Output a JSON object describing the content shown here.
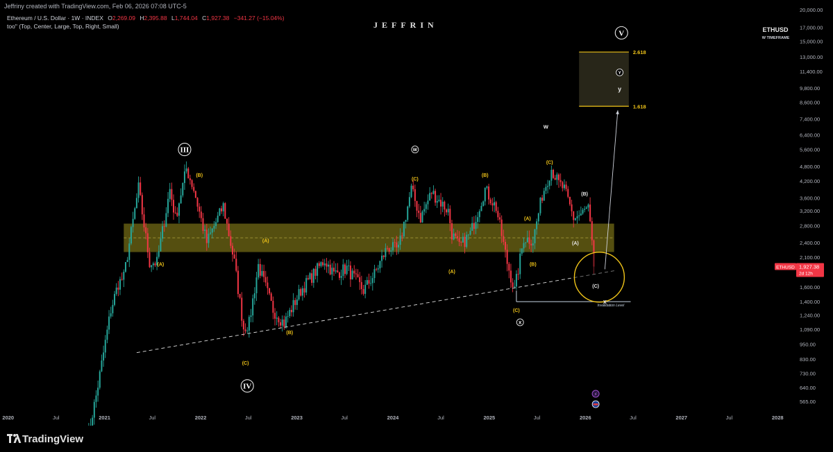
{
  "header": {
    "caption": "Jeffriny created with TradingView.com, Feb 06, 2026 07:08 UTC-5",
    "ohlc_title": "Ethereum / U.S. Dollar · 1W · INDEX",
    "o_label": "O",
    "o_value": "2,269.09",
    "h_label": "H",
    "h_value": "2,395.88",
    "l_label": "L",
    "l_value": "1,744.04",
    "c_label": "C",
    "c_value": "1,927.38",
    "change": "−341.27 (−15.04%)",
    "indicator": "too\" (Top, Center, Large, Top, Right, Small)",
    "brand": "JEFFRIN",
    "symbol": "ETHUSD",
    "timeframe": "W TIMEFRAME"
  },
  "footer": {
    "logo_text": "TradingView"
  },
  "colors": {
    "up": "#26a69a",
    "down": "#f23645",
    "zone": "#9a8f1e",
    "label": "#f0c419",
    "axis_text": "#b2b5be",
    "price_tag": "#f23645"
  },
  "chart_data": {
    "type": "candlestick",
    "y_scale": "log",
    "ylim": [
      520,
      20000
    ],
    "x_range": [
      "2019-12-01",
      "2028-03-01"
    ],
    "y_ticks": [
      565,
      640,
      730,
      830,
      950,
      1090,
      1240,
      1400,
      1600,
      2100,
      2400,
      2800,
      3200,
      3600,
      4200,
      4800,
      5600,
      6400,
      7400,
      8600,
      9800,
      11400,
      13000,
      15000,
      17000,
      20000
    ],
    "y_tick_labels": [
      "565.00",
      "640.00",
      "730.00",
      "830.00",
      "950.00",
      "1,090.00",
      "1,240.00",
      "1,400.00",
      "1,600.00",
      "2,100.00",
      "2,400.00",
      "2,800.00",
      "3,200.00",
      "3,600.00",
      "4,200.00",
      "4,800.00",
      "5,600.00",
      "6,400.00",
      "7,400.00",
      "8,600.00",
      "9,800.00",
      "11,400.00",
      "13,000.00",
      "15,000.00",
      "17,000.00",
      "20,000.00"
    ],
    "x_ticks": [
      {
        "date": "2020-01-01",
        "label": "2020",
        "bold": true
      },
      {
        "date": "2020-07-01",
        "label": "Jul",
        "bold": false
      },
      {
        "date": "2021-01-01",
        "label": "2021",
        "bold": true
      },
      {
        "date": "2021-07-01",
        "label": "Jul",
        "bold": false
      },
      {
        "date": "2022-01-01",
        "label": "2022",
        "bold": true
      },
      {
        "date": "2022-07-01",
        "label": "Jul",
        "bold": false
      },
      {
        "date": "2023-01-01",
        "label": "2023",
        "bold": true
      },
      {
        "date": "2023-07-01",
        "label": "Jul",
        "bold": false
      },
      {
        "date": "2024-01-01",
        "label": "2024",
        "bold": true
      },
      {
        "date": "2024-07-01",
        "label": "Jul",
        "bold": false
      },
      {
        "date": "2025-01-01",
        "label": "2025",
        "bold": true
      },
      {
        "date": "2025-07-01",
        "label": "Jul",
        "bold": false
      },
      {
        "date": "2026-01-01",
        "label": "2026",
        "bold": true
      },
      {
        "date": "2026-07-01",
        "label": "Jul",
        "bold": false
      },
      {
        "date": "2027-01-01",
        "label": "2027",
        "bold": true
      },
      {
        "date": "2027-07-01",
        "label": "Jul",
        "bold": false
      },
      {
        "date": "2028-01-01",
        "label": "2028",
        "bold": true
      }
    ],
    "price_anchors": [
      [
        "2020-10-26",
        395
      ],
      [
        "2020-12-01",
        600
      ],
      [
        "2021-01-25",
        1300
      ],
      [
        "2021-02-22",
        1650
      ],
      [
        "2021-03-15",
        1750
      ],
      [
        "2021-05-10",
        3950
      ],
      [
        "2021-06-21",
        2000
      ],
      [
        "2021-07-19",
        2000
      ],
      [
        "2021-09-06",
        3900
      ],
      [
        "2021-09-27",
        3000
      ],
      [
        "2021-11-08",
        4700
      ],
      [
        "2021-12-06",
        3900
      ],
      [
        "2022-01-24",
        2400
      ],
      [
        "2022-03-28",
        3350
      ],
      [
        "2022-05-09",
        2000
      ],
      [
        "2022-06-13",
        1100
      ],
      [
        "2022-07-04",
        1150
      ],
      [
        "2022-08-08",
        1950
      ],
      [
        "2022-10-03",
        1300
      ],
      [
        "2022-11-14",
        1150
      ],
      [
        "2023-01-16",
        1550
      ],
      [
        "2023-04-17",
        2050
      ],
      [
        "2023-05-22",
        1800
      ],
      [
        "2023-07-10",
        1900
      ],
      [
        "2023-09-11",
        1550
      ],
      [
        "2023-10-23",
        1800
      ],
      [
        "2023-12-11",
        2300
      ],
      [
        "2024-01-22",
        2250
      ],
      [
        "2024-03-11",
        3900
      ],
      [
        "2024-04-15",
        3000
      ],
      [
        "2024-05-27",
        3800
      ],
      [
        "2024-07-29",
        3200
      ],
      [
        "2024-08-12",
        2600
      ],
      [
        "2024-09-09",
        2300
      ],
      [
        "2024-10-21",
        2600
      ],
      [
        "2024-12-16",
        3900
      ],
      [
        "2025-01-27",
        3300
      ],
      [
        "2025-03-10",
        2000
      ],
      [
        "2025-04-07",
        1550
      ],
      [
        "2025-05-12",
        2500
      ],
      [
        "2025-06-16",
        2450
      ],
      [
        "2025-07-21",
        3700
      ],
      [
        "2025-08-25",
        4700
      ],
      [
        "2025-09-22",
        4100
      ],
      [
        "2025-10-13",
        3900
      ],
      [
        "2025-11-17",
        3000
      ],
      [
        "2025-12-15",
        3100
      ],
      [
        "2026-01-12",
        3300
      ],
      [
        "2026-01-26",
        2350
      ],
      [
        "2026-02-02",
        1927
      ]
    ],
    "last_price": {
      "value": 1927.38,
      "label": "1,927.38",
      "countdown": "2d 12h",
      "symbol": "ETHUSD"
    },
    "zones": [
      {
        "name": "support-resistance",
        "from": "2021-03-15",
        "to": "2026-04-20",
        "low": 2200,
        "high": 2850
      },
      {
        "name": "target",
        "from": "2025-12-08",
        "to": "2026-06-15",
        "low": 8300,
        "high": 13600
      }
    ],
    "fib_levels": [
      {
        "value": 13600,
        "label": "2.618"
      },
      {
        "value": 8300,
        "label": "1.618"
      }
    ],
    "trendline": {
      "from": [
        "2021-05-03",
        880
      ],
      "to": [
        "2026-04-27",
        1860
      ]
    },
    "invalidation": {
      "from": [
        "2025-04-14",
        1400
      ],
      "to": [
        "2026-06-22",
        1400
      ],
      "label": "Invalidation Level"
    },
    "projection_arrow": {
      "from": [
        "2026-03-16",
        1880
      ],
      "to": [
        "2026-05-04",
        8000
      ]
    },
    "target_circle": {
      "center": [
        "2026-02-23",
        1750
      ],
      "radius_label": ""
    },
    "wave_labels": [
      {
        "text": "III",
        "date": "2021-11-01",
        "price": 5600,
        "style": "circle"
      },
      {
        "text": "IV",
        "date": "2022-06-27",
        "price": 650,
        "style": "circle"
      },
      {
        "text": "V",
        "date": "2026-05-18",
        "price": 16200,
        "style": "circle"
      },
      {
        "text": "W",
        "date": "2024-03-25",
        "price": 5600,
        "style": "small-circle"
      },
      {
        "text": "X",
        "date": "2025-04-28",
        "price": 1160,
        "style": "small-circle"
      },
      {
        "text": "Y",
        "date": "2026-05-11",
        "price": 11300,
        "style": "small-circle"
      },
      {
        "text": "w",
        "date": "2025-08-04",
        "price": 6900,
        "style": "plain"
      },
      {
        "text": "y",
        "date": "2026-05-11",
        "price": 9700,
        "style": "plain"
      },
      {
        "text": "x",
        "date": "2026-03-16",
        "price": 1400,
        "style": "plain"
      },
      {
        "text": "(A)",
        "date": "2021-08-02",
        "price": 1980,
        "style": "yellow"
      },
      {
        "text": "(B)",
        "date": "2021-12-27",
        "price": 4450,
        "style": "yellow"
      },
      {
        "text": "(C)",
        "date": "2022-06-20",
        "price": 805,
        "style": "yellow"
      },
      {
        "text": "(A)",
        "date": "2022-09-05",
        "price": 2450,
        "style": "yellow"
      },
      {
        "text": "(B)",
        "date": "2022-12-05",
        "price": 1060,
        "style": "yellow"
      },
      {
        "text": "(C)",
        "date": "2024-03-25",
        "price": 4300,
        "style": "yellow"
      },
      {
        "text": "(A)",
        "date": "2024-08-12",
        "price": 1850,
        "style": "yellow"
      },
      {
        "text": "(B)",
        "date": "2024-12-16",
        "price": 4450,
        "style": "yellow"
      },
      {
        "text": "(C)",
        "date": "2025-04-14",
        "price": 1300,
        "style": "yellow"
      },
      {
        "text": "(A)",
        "date": "2025-05-26",
        "price": 3000,
        "style": "yellow"
      },
      {
        "text": "(B)",
        "date": "2025-06-16",
        "price": 1980,
        "style": "yellow"
      },
      {
        "text": "(C)",
        "date": "2025-08-18",
        "price": 5000,
        "style": "yellow"
      },
      {
        "text": "(B)",
        "date": "2025-12-29",
        "price": 3750,
        "style": "white"
      },
      {
        "text": "(A)",
        "date": "2025-11-24",
        "price": 2400,
        "style": "white"
      },
      {
        "text": "(C)",
        "date": "2026-02-09",
        "price": 1620,
        "style": "white"
      }
    ]
  }
}
